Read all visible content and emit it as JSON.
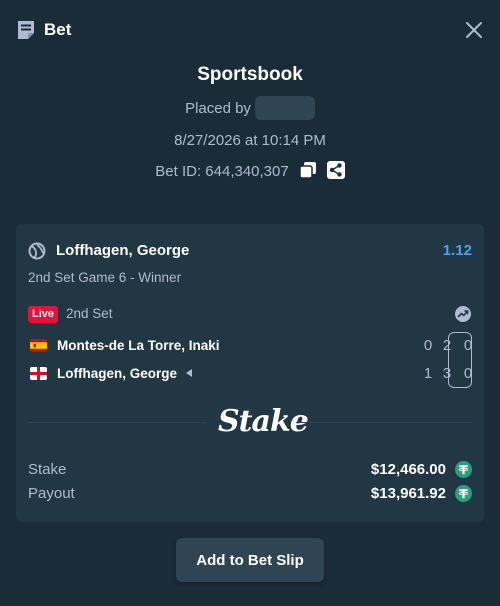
{
  "header": {
    "title": "Bet",
    "icon": "receipt-icon",
    "close_icon": "close-icon"
  },
  "bet_info": {
    "source": "Sportsbook",
    "placed_by_label": "Placed by",
    "datetime": "8/27/2026 at 10:14 PM",
    "bet_id_label": "Bet ID: 644,340,307"
  },
  "selection": {
    "sport_icon": "tennis-ball-icon",
    "name": "Loffhagen, George",
    "odds": "1.12",
    "market": "2nd Set Game 6 - Winner",
    "live_badge": "Live",
    "status": "2nd Set",
    "players": [
      {
        "name": "Montes-de La Torre, Inaki",
        "flag": "spain-flag-icon",
        "scores": [
          "0",
          "2",
          "0"
        ],
        "serving": false
      },
      {
        "name": "Loffhagen, George",
        "flag": "england-flag-icon",
        "scores": [
          "1",
          "3",
          "0"
        ],
        "serving": true
      }
    ]
  },
  "brand": "Stake",
  "summary": {
    "stake_label": "Stake",
    "stake_value": "$12,466.00",
    "payout_label": "Payout",
    "payout_value": "$13,961.92",
    "currency_icon": "usdt-coin-icon"
  },
  "actions": {
    "add_to_slip": "Add to Bet Slip"
  },
  "colors": {
    "background": "#1a2c38",
    "card": "#213743",
    "muted_text": "#b1bad3",
    "odds": "#4ca1f0",
    "live": "#e9113c",
    "usdt": "#26a17b",
    "button": "#2f4553"
  }
}
